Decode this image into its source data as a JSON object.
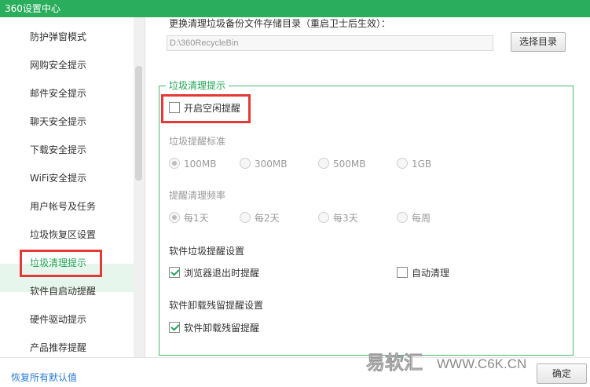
{
  "window": {
    "title": "360设置中心"
  },
  "sidebar": {
    "items": [
      {
        "label": "防护弹窗模式"
      },
      {
        "label": "网购安全提示"
      },
      {
        "label": "邮件安全提示"
      },
      {
        "label": "聊天安全提示"
      },
      {
        "label": "下载安全提示"
      },
      {
        "label": "WiFi安全提示"
      },
      {
        "label": "用户帐号及任务"
      },
      {
        "label": "垃圾恢复区设置"
      },
      {
        "label": "垃圾清理提示"
      },
      {
        "label": "软件自启动提醒"
      },
      {
        "label": "硬件驱动提示"
      },
      {
        "label": "产品推荐提醒"
      }
    ],
    "active_index": 8
  },
  "backup": {
    "label": "更换清理垃圾备份文件存储目录（重启卫士后生效）：",
    "path": "D:\\360RecycleBin",
    "choose_button": "选择目录"
  },
  "cleanup": {
    "title": "垃圾清理提示",
    "idle_reminder": {
      "label": "开启空闲提醒",
      "checked": false
    },
    "standard": {
      "label": "垃圾提醒标准",
      "options": [
        "100MB",
        "300MB",
        "500MB",
        "1GB"
      ],
      "selected": "100MB"
    },
    "frequency": {
      "label": "提醒清理频率",
      "options": [
        "每1天",
        "每2天",
        "每3天",
        "每周"
      ],
      "selected": "每1天"
    },
    "software_section": {
      "label": "软件垃圾提醒设置",
      "browser_exit": {
        "label": "浏览器退出时提醒",
        "checked": true
      },
      "auto_clean": {
        "label": "自动清理",
        "checked": false
      }
    },
    "uninstall_section": {
      "label": "软件卸载残留提醒设置",
      "uninstall_residue": {
        "label": "软件卸载残留提醒",
        "checked": true
      }
    }
  },
  "footer": {
    "restore_link": "恢复所有默认值",
    "ok_button": "确定"
  },
  "watermark": {
    "brand": "易软汇",
    "site": "WWW.C6K.CN"
  },
  "colors": {
    "accent": "#2aae5e",
    "highlight": "#e53935",
    "link": "#2a7bd5"
  }
}
